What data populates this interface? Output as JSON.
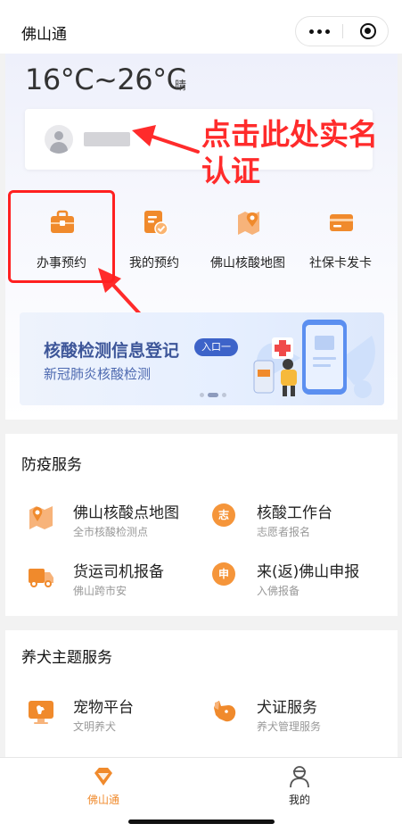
{
  "status_bar": {
    "left_fragment": "⋯",
    "right_fragment": "⋯"
  },
  "app": {
    "title": "佛山通"
  },
  "weather": {
    "temp_range": "16°C~26°C",
    "condition": "晴"
  },
  "annotation": {
    "text": "点击此处实名认证"
  },
  "quick_actions": [
    {
      "label": "办事预约",
      "icon": "briefcase-icon"
    },
    {
      "label": "我的预约",
      "icon": "appointment-doc-icon"
    },
    {
      "label": "佛山核酸地图",
      "icon": "map-pin-icon"
    },
    {
      "label": "社保卡发卡",
      "icon": "card-icon"
    }
  ],
  "banner": {
    "title": "核酸检测信息登记",
    "entry": "入口一",
    "subtitle": "新冠肺炎核酸检测",
    "active_slide": 1,
    "slides": 3
  },
  "epidemic_section": {
    "title": "防疫服务",
    "items": [
      {
        "name": "佛山核酸点地图",
        "desc": "全市核酸检测点",
        "icon": "map-icon"
      },
      {
        "name": "核酸工作台",
        "desc": "志愿者报名",
        "badge": "志",
        "icon": "volunteer-icon"
      },
      {
        "name": "货运司机报备",
        "desc": "佛山跨市安",
        "icon": "truck-icon"
      },
      {
        "name": "来(返)佛山申报",
        "desc": "入佛报备",
        "badge": "申",
        "icon": "declare-icon"
      }
    ]
  },
  "dog_section": {
    "title": "养犬主题服务",
    "items": [
      {
        "name": "宠物平台",
        "desc": "文明养犬",
        "icon": "pet-screen-icon"
      },
      {
        "name": "犬证服务",
        "desc": "养犬管理服务",
        "icon": "dog-icon"
      }
    ]
  },
  "tabbar": {
    "tabs": [
      {
        "label": "佛山通",
        "active": true,
        "icon": "diamond-icon"
      },
      {
        "label": "我的",
        "active": false,
        "icon": "person-icon"
      }
    ]
  },
  "colors": {
    "accent": "#f08a2c",
    "annotation": "#ff2b2b",
    "banner_title": "#3d5699"
  }
}
